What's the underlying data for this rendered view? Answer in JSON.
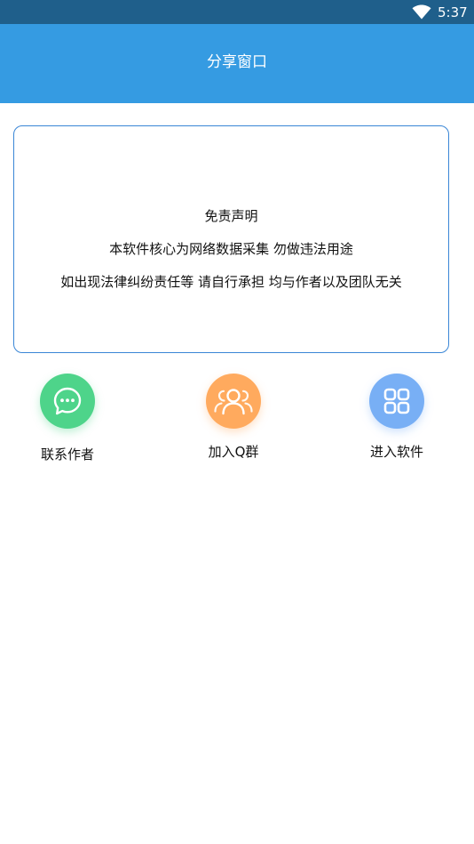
{
  "status_bar": {
    "time": "5:37",
    "wifi_icon": "wifi-icon",
    "background": "#1f5f8b"
  },
  "app_bar": {
    "title": "分享窗口",
    "background": "#359be2"
  },
  "notice": {
    "lines": [
      "免责声明",
      "本软件核心为网络数据采集 勿做违法用途",
      "如出现法律纠纷责任等 请自行承担 均与作者以及团队无关"
    ],
    "border_color": "#3a86d6"
  },
  "actions": [
    {
      "label": "联系作者",
      "icon": "chat-bubble-icon",
      "color": "#4ed48a"
    },
    {
      "label": "加入Q群",
      "icon": "users-group-icon",
      "color": "#ffaa5e"
    },
    {
      "label": "进入软件",
      "icon": "app-grid-icon",
      "color": "#78aff5"
    }
  ]
}
